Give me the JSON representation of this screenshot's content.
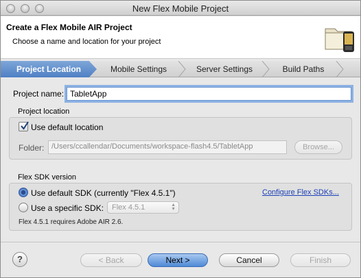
{
  "window": {
    "title": "New Flex Mobile Project"
  },
  "header": {
    "title": "Create a Flex Mobile AIR Project",
    "description": "Choose a name and location for your project",
    "icon": "folder-device-icon"
  },
  "tabs": [
    {
      "label": "Project Location",
      "active": true
    },
    {
      "label": "Mobile Settings",
      "active": false
    },
    {
      "label": "Server Settings",
      "active": false
    },
    {
      "label": "Build Paths",
      "active": false
    }
  ],
  "form": {
    "project_name_label": "Project name:",
    "project_name_value": "TabletApp",
    "project_location_heading": "Project location",
    "use_default_location_label": "Use default location",
    "use_default_location_checked": true,
    "folder_label": "Folder:",
    "folder_value": "/Users/ccallendar/Documents/workspace-flash4.5/TabletApp",
    "browse_label": "Browse...",
    "sdk_heading": "Flex SDK version",
    "use_default_sdk_label": "Use default SDK (currently \"Flex 4.5.1\")",
    "configure_sdks_link": "Configure Flex SDKs...",
    "use_specific_sdk_label": "Use a specific SDK:",
    "specific_sdk_value": "Flex 4.5.1",
    "sdk_note": "Flex 4.5.1 requires Adobe AIR 2.6."
  },
  "footer": {
    "help_label": "?",
    "back_label": "< Back",
    "next_label": "Next >",
    "cancel_label": "Cancel",
    "finish_label": "Finish"
  },
  "colors": {
    "active_tab": "#4f80c4",
    "link": "#1a3fb5",
    "focus_ring": "#8db2e3"
  }
}
